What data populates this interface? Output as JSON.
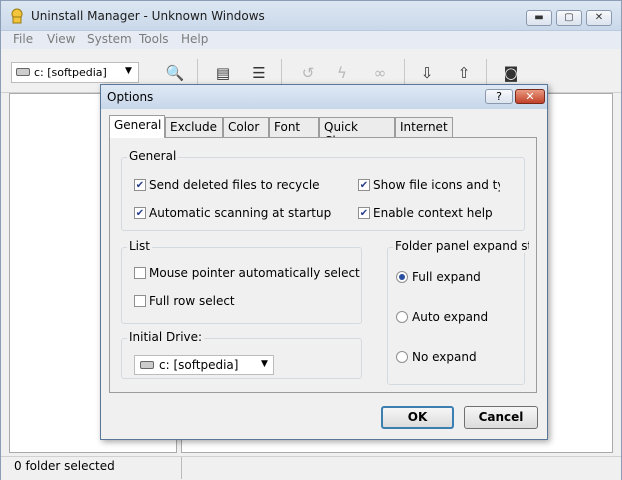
{
  "app": {
    "title": "Uninstall Manager - Unknown Windows",
    "menu": [
      "File",
      "View",
      "System",
      "Tools",
      "Help"
    ],
    "drive_combo": "c: [softpedia]",
    "status": "0 folder selected"
  },
  "dialog": {
    "title": "Options",
    "help_label": "?",
    "close_label": "✕",
    "tabs": [
      "General",
      "Exclude",
      "Color",
      "Font",
      "Quick Clean",
      "Internet"
    ],
    "active_tab": "General",
    "general_group": {
      "title": "General",
      "items": [
        {
          "label": "Send deleted files to recycle bi",
          "checked": true
        },
        {
          "label": "Show file icons and typ",
          "checked": true
        },
        {
          "label": "Automatic scanning at startup",
          "checked": true
        },
        {
          "label": "Enable context help",
          "checked": true
        }
      ]
    },
    "list_group": {
      "title": "List",
      "items": [
        {
          "label": "Mouse pointer automatically selects",
          "checked": false
        },
        {
          "label": "Full row select",
          "checked": false
        }
      ]
    },
    "folder_group": {
      "title": "Folder panel expand st",
      "options": [
        {
          "label": "Full expand",
          "selected": true
        },
        {
          "label": "Auto expand",
          "selected": false
        },
        {
          "label": "No expand",
          "selected": false
        }
      ]
    },
    "drive_group": {
      "title": "Initial Drive:",
      "value": "c: [softpedia]"
    },
    "ok_label": "OK",
    "cancel_label": "Cancel"
  }
}
